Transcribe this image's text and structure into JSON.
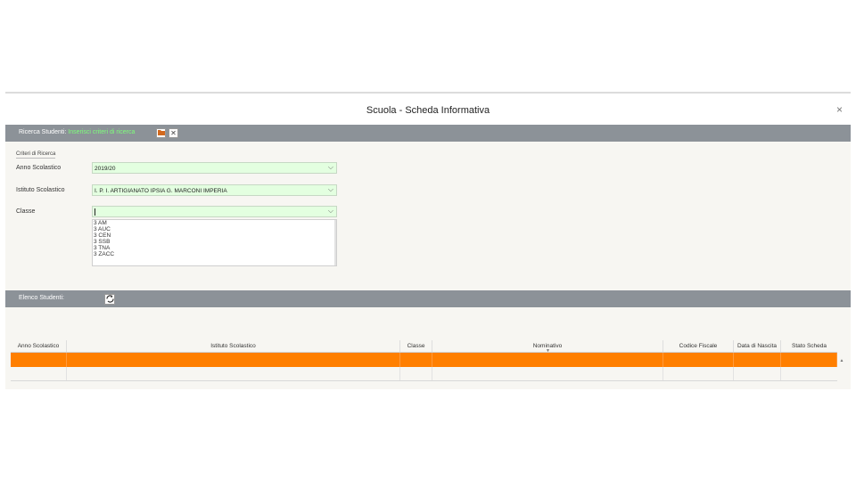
{
  "window": {
    "title": "Scuola - Scheda Informativa",
    "close_label": "×"
  },
  "search_bar": {
    "label": "Ricerca Studenti:",
    "hint": "Inserisci criteri di ricerca",
    "open_icon": "folder-icon",
    "clear_label": "✕"
  },
  "criteria": {
    "section_title": "Criteri di Ricerca",
    "anno": {
      "label": "Anno Scolastico",
      "value": "2019/20"
    },
    "istituto": {
      "label": "Istituto Scolastico",
      "value": "I. P. I. ARTIGIANATO IPSIA G. MARCONI IMPERIA"
    },
    "classe": {
      "label": "Classe",
      "value": ""
    },
    "classe_options": [
      "3 AM",
      "3 AUC",
      "3 CEN",
      "3 SSB",
      "3 TNA",
      "3 ZACC"
    ]
  },
  "students_bar": {
    "label": "Elenco Studenti:",
    "refresh_icon": "refresh-icon"
  },
  "grid": {
    "columns": [
      "Anno Scolastico",
      "Istituto Scolastico",
      "Classe",
      "Nominativo",
      "Codice Fiscale",
      "Data di Nascita",
      "Stato Scheda"
    ],
    "sort_glyph": "▼",
    "scroll_glyph": "▲"
  },
  "colors": {
    "header_bar": "#8c9298",
    "hint_green": "#7dff7a",
    "select_bg": "#e3ffe0",
    "selected_row": "#ff7f00"
  }
}
